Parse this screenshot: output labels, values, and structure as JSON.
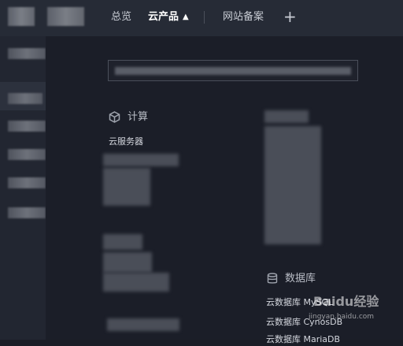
{
  "nav": {
    "items": [
      {
        "label": "总览",
        "active": false
      },
      {
        "label": "云产品",
        "active": true
      },
      {
        "label": "网站备案",
        "active": false
      }
    ],
    "add_label": "+"
  },
  "categories": {
    "compute": {
      "title": "计算",
      "icon": "cube-icon",
      "links": [
        "云服务器"
      ]
    },
    "database": {
      "title": "数据库",
      "icon": "database-icon",
      "links": [
        "云数据库 MySQL",
        "云数据库 CynosDB",
        "云数据库 MariaDB"
      ]
    }
  },
  "watermark": {
    "brand": "Baidu经验",
    "url": "jingyan.baidu.com"
  },
  "colors": {
    "background": "#1b1e28",
    "topbar": "#262b36",
    "sidebar": "#222631",
    "text": "#d4d7de"
  }
}
